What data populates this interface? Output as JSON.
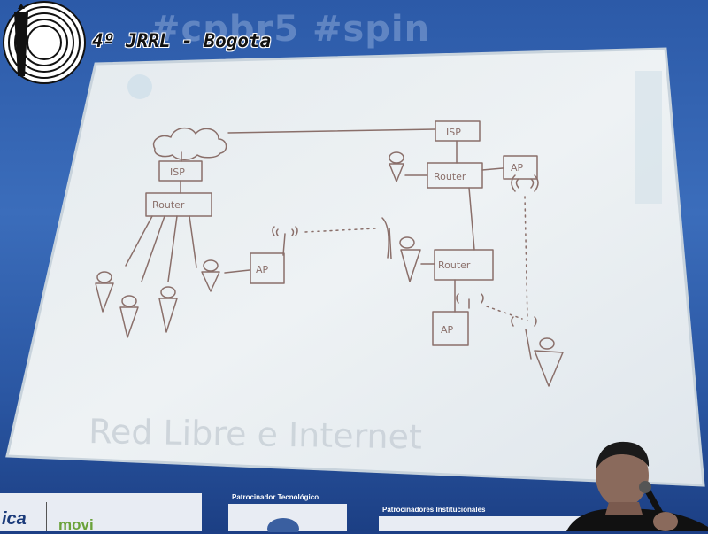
{
  "overlay": {
    "title": "4º JRRL - Bogota",
    "logo_icon": "radio-tower-logo-icon"
  },
  "backdrop": {
    "banner_text": "#cpbr5 #spin"
  },
  "screen": {
    "watermark_text": "Red Libre e Internet",
    "diagram_labels": {
      "isp_left": "ISP",
      "isp_right": "ISP",
      "router_left": "Router",
      "router_top_right": "Router",
      "router_mid_right": "Router",
      "ap_center": "AP",
      "ap_top_right": "AP",
      "ap_bottom": "AP"
    }
  },
  "sponsors": {
    "tech_label": "Patrocinador Tecnológico",
    "institutional_label": "Patrocinadores Institucionales",
    "left_fragment": "ica",
    "movistar_fragment": "movi"
  },
  "colors": {
    "backdrop": "#2c5aa8",
    "screen": "#e9eef2",
    "pen": "#8a6f6a"
  }
}
